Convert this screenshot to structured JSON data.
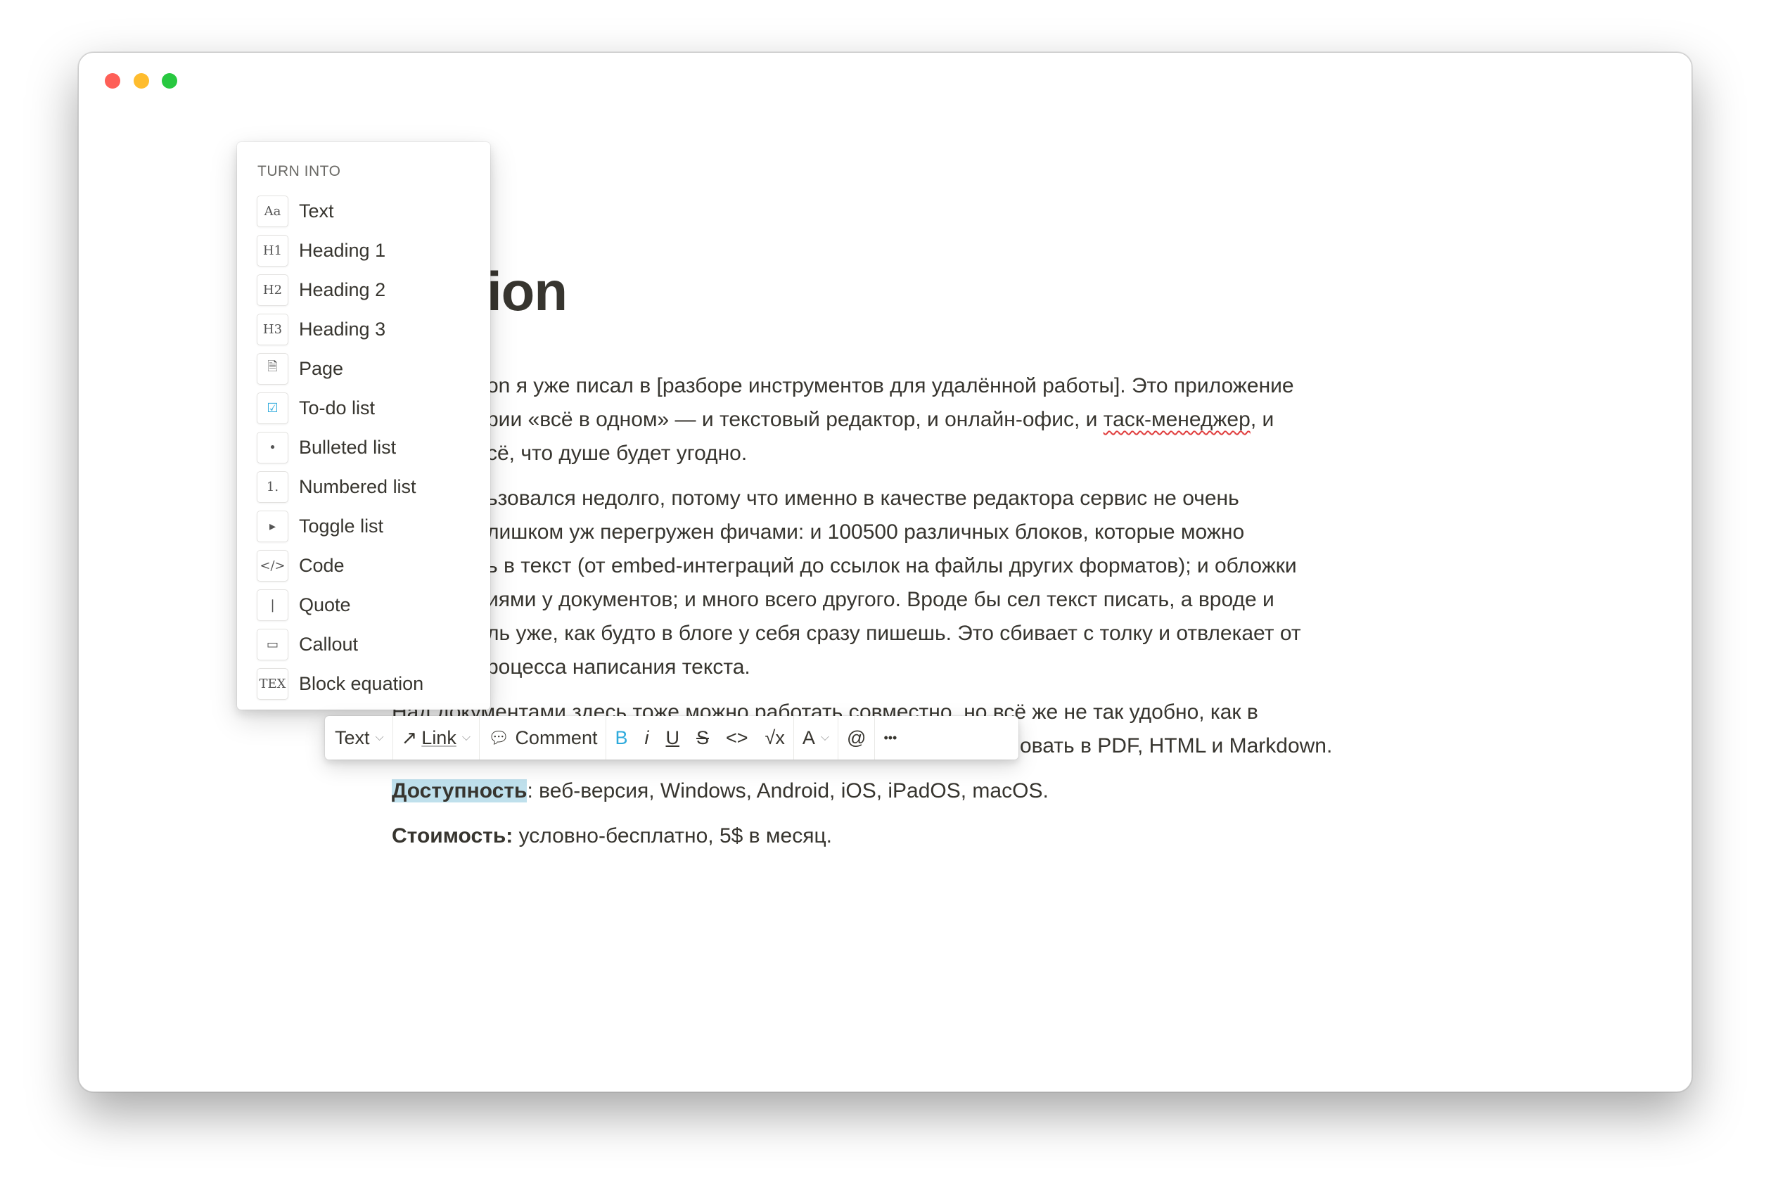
{
  "window": {
    "traffic_lights": {
      "close": "#fe5f57",
      "minimize": "#febc2e",
      "zoom": "#28c840"
    }
  },
  "page": {
    "title_visible": "ion",
    "lines": [
      "on я уже писал в [разборе инструментов для удалённой работы]. Это приложение",
      "рии «всё в одном» — и текстовый редактор, и онлайн-офис, и ",
      "таск-менеджер",
      ", и",
      "сё, что душе будет угодно.",
      "ьзовался недолго, потому что именно в качестве редактора сервис не очень",
      "лишком уж перегружен фичами: и 100500 различных блоков, которые можно",
      "ь в текст (от embed-интеграций до ссылок на файлы других форматов); и обложки",
      "иями у документов; и много всего другого. Вроде бы сел текст писать, а вроде и",
      "ль уже, как будто в блоге у себя сразу пишешь. Это сбивает с толку и отвлекает от",
      "роцесса написания текста.",
      "Над документами здесь тоже можно работать совместно, но всё же не так удобно, как в",
      "овать в PDF, HTML и Markdown."
    ],
    "availability": {
      "label": "Доступность",
      "text": ": веб-версия, Windows, Android, iOS, iPadOS, macOS."
    },
    "cost": {
      "label": "Стоимость:",
      "text": " условно-бесплатно, 5$ в месяц."
    },
    "highlight_color": "#bfe0ec"
  },
  "turn_into": {
    "header": "TURN INTO",
    "items": [
      {
        "label": "Text",
        "icon": "Aa"
      },
      {
        "label": "Heading 1",
        "icon": "H1"
      },
      {
        "label": "Heading 2",
        "icon": "H2"
      },
      {
        "label": "Heading 3",
        "icon": "H3"
      },
      {
        "label": "Page",
        "icon": "🗎"
      },
      {
        "label": "To-do list",
        "icon": "☑"
      },
      {
        "label": "Bulleted list",
        "icon": "•"
      },
      {
        "label": "Numbered list",
        "icon": "1."
      },
      {
        "label": "Toggle list",
        "icon": "▸"
      },
      {
        "label": "Code",
        "icon": "</>"
      },
      {
        "label": "Quote",
        "icon": "❘"
      },
      {
        "label": "Callout",
        "icon": "▭"
      },
      {
        "label": "Block equation",
        "icon": "TEX"
      }
    ]
  },
  "toolbar": {
    "text": "Text",
    "link": "Link",
    "comment": "Comment",
    "bold": "B",
    "italic": "i",
    "underline": "U",
    "strike": "S",
    "code": "<>",
    "math": "√x",
    "color": "A",
    "mention": "@",
    "more": "•••",
    "accent": "#2eaadc"
  }
}
